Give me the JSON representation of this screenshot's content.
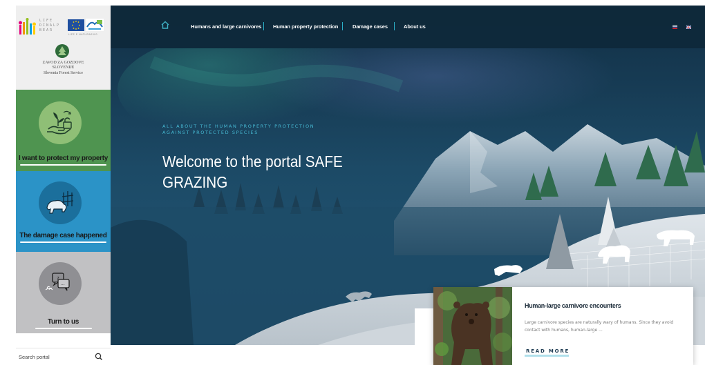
{
  "brand": {
    "life_text": "LIFE\nDINALP\nBEAR",
    "natura_text": "LIFE E NATURA2000",
    "zgs_name": "ZAVOD ZA GOZDOVE\nSLOVENIJE",
    "zgs_subtitle": "Slovenia Forest Service"
  },
  "sidebar": {
    "panels": [
      {
        "label": "I want to protect my property",
        "icon": "hand-plant-lock-icon"
      },
      {
        "label": "The damage case happened",
        "icon": "bear-fence-icon"
      },
      {
        "label": "Turn to us",
        "icon": "chat-bubbles-icon"
      }
    ],
    "search": {
      "placeholder": "Search portal",
      "value": ""
    }
  },
  "nav": {
    "home_icon": "home-icon",
    "items": [
      "Humans and large carnivores",
      "Human property protection",
      "Damage cases",
      "About us"
    ],
    "languages": [
      "sl",
      "en"
    ]
  },
  "hero": {
    "eyebrow_line1": "ALL ABOUT THE HUMAN PROPERTY PROTECTION",
    "eyebrow_line2": "AGAINST PROTECTED SPECIES",
    "title": "Welcome to the portal SAFE GRAZING"
  },
  "card": {
    "title": "Human-large carnivore encounters",
    "text": "Large carnivore species are naturally wary of humans.  Since they avoid contact with humans, human-large ...",
    "button": "READ MORE"
  },
  "colors": {
    "protect": "#4f9450",
    "damage": "#2b93c7",
    "turn": "#c1c1c3",
    "accent": "#2bb0c8",
    "nav_bg": "#0e283a"
  }
}
